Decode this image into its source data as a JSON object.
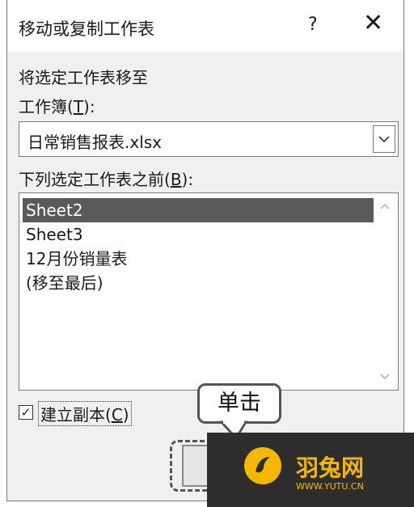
{
  "dialog": {
    "title": "移动或复制工作表",
    "help": "?",
    "close": "✕",
    "move_to_label": "将选定工作表移至",
    "workbook_label_prefix": "工作簿(",
    "workbook_label_key": "T",
    "workbook_label_suffix": "):",
    "workbook_value": "日常销售报表.xlsx",
    "before_label_prefix": "下列选定工作表之前(",
    "before_label_key": "B",
    "before_label_suffix": "):",
    "sheets": [
      "Sheet2",
      "Sheet3",
      "12月份销量表",
      "(移至最后)"
    ],
    "selected_index": 0,
    "copy_checked": true,
    "copy_label_prefix": "建立副本(",
    "copy_label_key": "C",
    "copy_label_suffix": ")",
    "checkmark": "✓"
  },
  "annotation": {
    "callout": "单击"
  },
  "watermark": {
    "name": "羽兔网",
    "url": "WWW.YUTU.CN",
    "color": "#f5b800"
  }
}
